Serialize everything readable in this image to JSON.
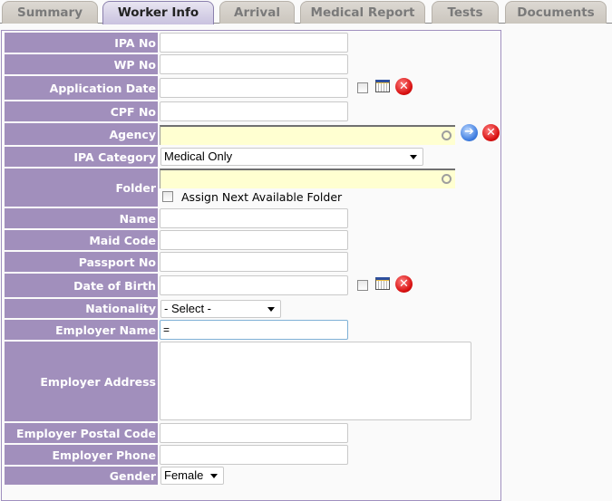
{
  "tabs": [
    {
      "label": "Summary",
      "active": false
    },
    {
      "label": "Worker Info",
      "active": true
    },
    {
      "label": "Arrival",
      "active": false
    },
    {
      "label": "Medical Report",
      "active": false
    },
    {
      "label": "Tests",
      "active": false
    },
    {
      "label": "Documents",
      "active": false
    }
  ],
  "form": {
    "ipa_no": {
      "label": "IPA No",
      "value": ""
    },
    "wp_no": {
      "label": "WP No",
      "value": ""
    },
    "application_date": {
      "label": "Application Date",
      "value": "",
      "calendar_icon": "calendar-icon",
      "clear_icon": "clear-icon"
    },
    "cpf_no": {
      "label": "CPF No",
      "value": ""
    },
    "agency": {
      "label": "Agency",
      "value": "",
      "go_icon": "arrow-right-circle-icon",
      "clear_icon": "clear-icon"
    },
    "ipa_category": {
      "label": "IPA Category",
      "selected": "Medical Only"
    },
    "folder": {
      "label": "Folder",
      "value": "",
      "checkbox_label": "Assign Next Available Folder"
    },
    "name": {
      "label": "Name",
      "value": ""
    },
    "maid_code": {
      "label": "Maid Code",
      "value": ""
    },
    "passport_no": {
      "label": "Passport No",
      "value": ""
    },
    "date_of_birth": {
      "label": "Date of Birth",
      "value": "",
      "calendar_icon": "calendar-icon",
      "clear_icon": "clear-icon"
    },
    "nationality": {
      "label": "Nationality",
      "selected": "- Select -"
    },
    "employer_name": {
      "label": "Employer Name",
      "value": "="
    },
    "employer_address": {
      "label": "Employer Address",
      "value": ""
    },
    "employer_postal_code": {
      "label": "Employer Postal Code",
      "value": ""
    },
    "employer_phone": {
      "label": "Employer Phone",
      "value": ""
    },
    "gender": {
      "label": "Gender",
      "selected": "Female"
    }
  },
  "colors": {
    "label_bg": "#a18fbc",
    "panel_border": "#a090bf",
    "lookup_bg": "#ffffd1"
  }
}
